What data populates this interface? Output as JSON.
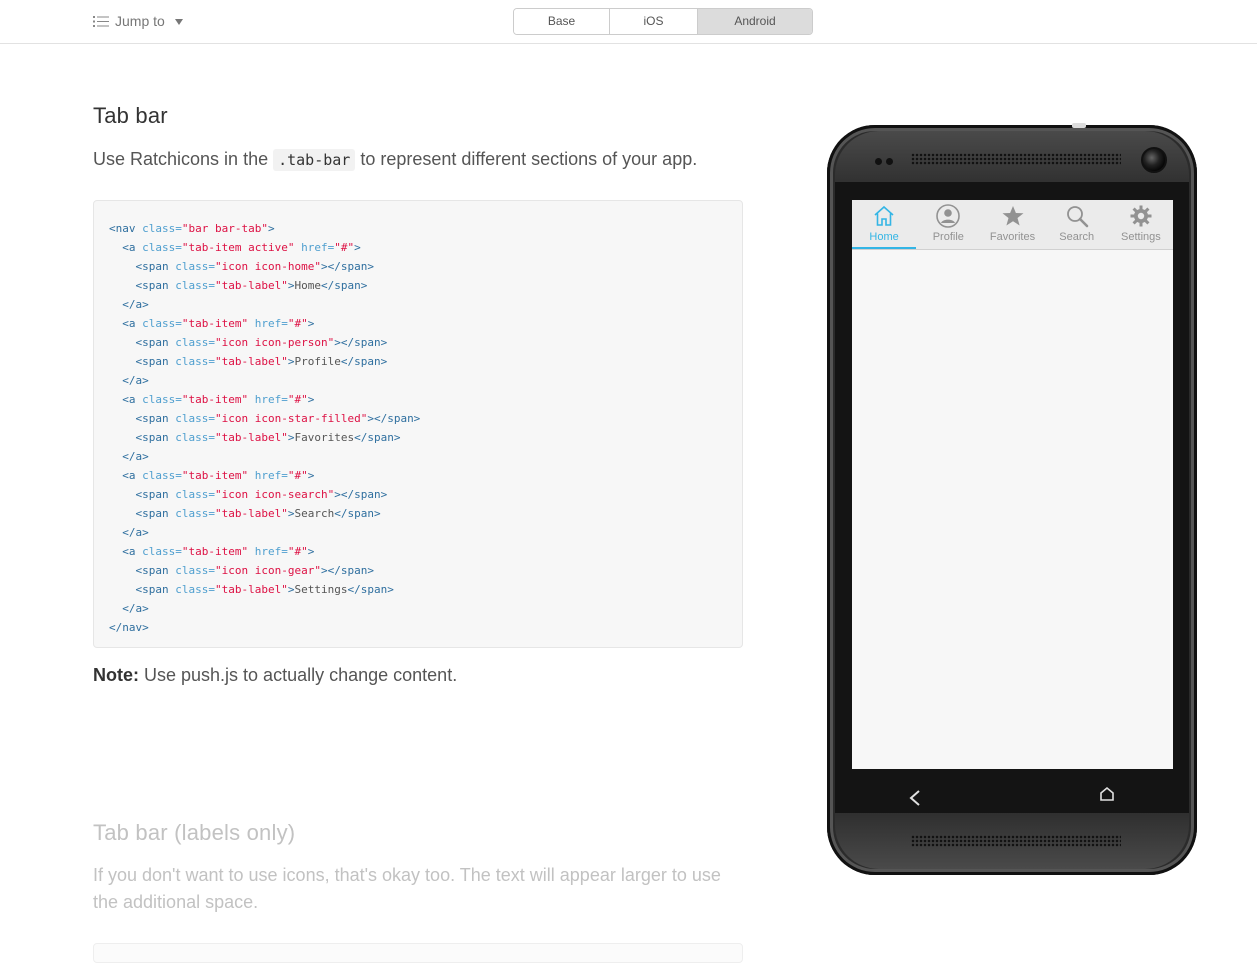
{
  "topbar": {
    "jump_label": "Jump to",
    "platforms": [
      {
        "label": "Base",
        "active": false
      },
      {
        "label": "iOS",
        "active": false
      },
      {
        "label": "Android",
        "active": true
      }
    ]
  },
  "section1": {
    "title": "Tab bar",
    "lead_before": "Use Ratchicons in the ",
    "lead_code": ".tab-bar",
    "lead_after": " to represent different sections of your app.",
    "note_label": "Note:",
    "note_text": " Use push.js to actually change content."
  },
  "code_lines": [
    [
      [
        "t",
        "<nav "
      ],
      [
        "a",
        "class="
      ],
      [
        "v",
        "\"bar bar-tab\""
      ],
      [
        "t",
        ">"
      ]
    ],
    [
      [
        "x",
        "  "
      ],
      [
        "t",
        "<a "
      ],
      [
        "a",
        "class="
      ],
      [
        "v",
        "\"tab-item active\""
      ],
      [
        "a",
        " href="
      ],
      [
        "v",
        "\"#\""
      ],
      [
        "t",
        ">"
      ]
    ],
    [
      [
        "x",
        "    "
      ],
      [
        "t",
        "<span "
      ],
      [
        "a",
        "class="
      ],
      [
        "v",
        "\"icon icon-home\""
      ],
      [
        "t",
        "></span>"
      ]
    ],
    [
      [
        "x",
        "    "
      ],
      [
        "t",
        "<span "
      ],
      [
        "a",
        "class="
      ],
      [
        "v",
        "\"tab-label\""
      ],
      [
        "t",
        ">"
      ],
      [
        "x",
        "Home"
      ],
      [
        "t",
        "</span>"
      ]
    ],
    [
      [
        "x",
        "  "
      ],
      [
        "t",
        "</a>"
      ]
    ],
    [
      [
        "x",
        "  "
      ],
      [
        "t",
        "<a "
      ],
      [
        "a",
        "class="
      ],
      [
        "v",
        "\"tab-item\""
      ],
      [
        "a",
        " href="
      ],
      [
        "v",
        "\"#\""
      ],
      [
        "t",
        ">"
      ]
    ],
    [
      [
        "x",
        "    "
      ],
      [
        "t",
        "<span "
      ],
      [
        "a",
        "class="
      ],
      [
        "v",
        "\"icon icon-person\""
      ],
      [
        "t",
        "></span>"
      ]
    ],
    [
      [
        "x",
        "    "
      ],
      [
        "t",
        "<span "
      ],
      [
        "a",
        "class="
      ],
      [
        "v",
        "\"tab-label\""
      ],
      [
        "t",
        ">"
      ],
      [
        "x",
        "Profile"
      ],
      [
        "t",
        "</span>"
      ]
    ],
    [
      [
        "x",
        "  "
      ],
      [
        "t",
        "</a>"
      ]
    ],
    [
      [
        "x",
        "  "
      ],
      [
        "t",
        "<a "
      ],
      [
        "a",
        "class="
      ],
      [
        "v",
        "\"tab-item\""
      ],
      [
        "a",
        " href="
      ],
      [
        "v",
        "\"#\""
      ],
      [
        "t",
        ">"
      ]
    ],
    [
      [
        "x",
        "    "
      ],
      [
        "t",
        "<span "
      ],
      [
        "a",
        "class="
      ],
      [
        "v",
        "\"icon icon-star-filled\""
      ],
      [
        "t",
        "></span>"
      ]
    ],
    [
      [
        "x",
        "    "
      ],
      [
        "t",
        "<span "
      ],
      [
        "a",
        "class="
      ],
      [
        "v",
        "\"tab-label\""
      ],
      [
        "t",
        ">"
      ],
      [
        "x",
        "Favorites"
      ],
      [
        "t",
        "</span>"
      ]
    ],
    [
      [
        "x",
        "  "
      ],
      [
        "t",
        "</a>"
      ]
    ],
    [
      [
        "x",
        "  "
      ],
      [
        "t",
        "<a "
      ],
      [
        "a",
        "class="
      ],
      [
        "v",
        "\"tab-item\""
      ],
      [
        "a",
        " href="
      ],
      [
        "v",
        "\"#\""
      ],
      [
        "t",
        ">"
      ]
    ],
    [
      [
        "x",
        "    "
      ],
      [
        "t",
        "<span "
      ],
      [
        "a",
        "class="
      ],
      [
        "v",
        "\"icon icon-search\""
      ],
      [
        "t",
        "></span>"
      ]
    ],
    [
      [
        "x",
        "    "
      ],
      [
        "t",
        "<span "
      ],
      [
        "a",
        "class="
      ],
      [
        "v",
        "\"tab-label\""
      ],
      [
        "t",
        ">"
      ],
      [
        "x",
        "Search"
      ],
      [
        "t",
        "</span>"
      ]
    ],
    [
      [
        "x",
        "  "
      ],
      [
        "t",
        "</a>"
      ]
    ],
    [
      [
        "x",
        "  "
      ],
      [
        "t",
        "<a "
      ],
      [
        "a",
        "class="
      ],
      [
        "v",
        "\"tab-item\""
      ],
      [
        "a",
        " href="
      ],
      [
        "v",
        "\"#\""
      ],
      [
        "t",
        ">"
      ]
    ],
    [
      [
        "x",
        "    "
      ],
      [
        "t",
        "<span "
      ],
      [
        "a",
        "class="
      ],
      [
        "v",
        "\"icon icon-gear\""
      ],
      [
        "t",
        "></span>"
      ]
    ],
    [
      [
        "x",
        "    "
      ],
      [
        "t",
        "<span "
      ],
      [
        "a",
        "class="
      ],
      [
        "v",
        "\"tab-label\""
      ],
      [
        "t",
        ">"
      ],
      [
        "x",
        "Settings"
      ],
      [
        "t",
        "</span>"
      ]
    ],
    [
      [
        "x",
        "  "
      ],
      [
        "t",
        "</a>"
      ]
    ],
    [
      [
        "t",
        "</nav>"
      ]
    ]
  ],
  "section2": {
    "title": "Tab bar (labels only)",
    "lead": "If you don't want to use icons, that's okay too. The text will appear larger to use the additional space."
  },
  "phone": {
    "tabs": [
      {
        "label": "Home",
        "icon": "home-icon",
        "active": true
      },
      {
        "label": "Profile",
        "icon": "person-icon",
        "active": false
      },
      {
        "label": "Favorites",
        "icon": "star-icon",
        "active": false
      },
      {
        "label": "Search",
        "icon": "search-icon",
        "active": false
      },
      {
        "label": "Settings",
        "icon": "gear-icon",
        "active": false
      }
    ],
    "accent_color": "#33b5e5",
    "inactive_color": "#929292"
  }
}
